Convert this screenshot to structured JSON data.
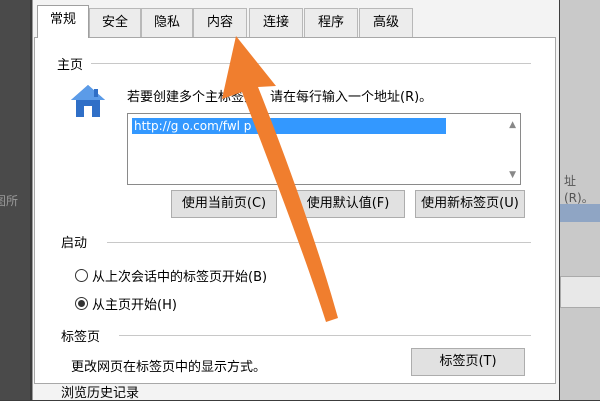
{
  "window": {
    "background_left_text": "图所",
    "background_right_text": "址(R)。"
  },
  "tabs": [
    {
      "label": "常规",
      "active": true
    },
    {
      "label": "安全",
      "active": false
    },
    {
      "label": "隐私",
      "active": false
    },
    {
      "label": "内容",
      "active": false
    },
    {
      "label": "连接",
      "active": false
    },
    {
      "label": "程序",
      "active": false
    },
    {
      "label": "高级",
      "active": false
    }
  ],
  "homepage": {
    "section_title": "主页",
    "description": "若要创建多个主标签页，请在每行输入一个地址(R)。",
    "url_value": "http://g          o.com/fwl                        p",
    "buttons": {
      "use_current": "使用当前页(C)",
      "use_default": "使用默认值(F)",
      "use_new_tab": "使用新标签页(U)"
    }
  },
  "startup": {
    "section_title": "启动",
    "option_last_session": "从上次会话中的标签页开始(B)",
    "option_homepage": "从主页开始(H)",
    "selected": "option_homepage"
  },
  "tabs_section": {
    "section_title": "标签页",
    "description": "更改网页在标签页中的显示方式。",
    "button": "标签页(T)"
  },
  "history": {
    "section_title": "浏览历史记录"
  },
  "colors": {
    "accent_arrow": "#f07e2e",
    "selection": "#3398ff"
  }
}
